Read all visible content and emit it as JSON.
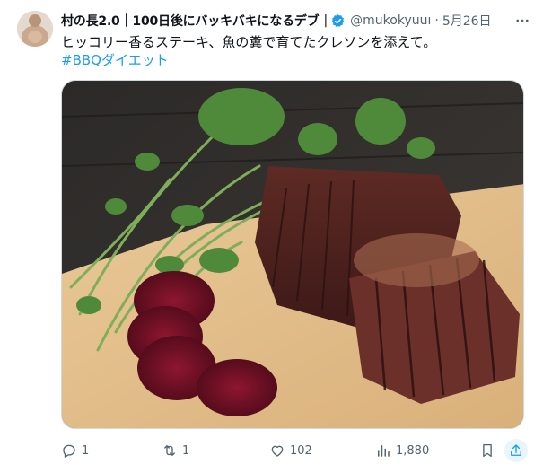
{
  "post": {
    "display_name": "村の長2.0｜100日後にバッキバキになるデブ",
    "separator": "|",
    "handle": "@mukokyuuı",
    "dot": "·",
    "date": "5月26日",
    "text": "ヒッコリー香るステーキ、魚の糞で育てたクレソンを添えて。",
    "hashtag": "#BBQダイエット"
  },
  "actions": {
    "reply_count": "1",
    "repost_count": "1",
    "like_count": "102",
    "view_count": "1,880"
  },
  "colors": {
    "accent": "#1d9bf0",
    "muted": "#536471",
    "text": "#0f1419"
  },
  "icons": [
    "verified-badge-icon",
    "more-icon",
    "reply-icon",
    "repost-icon",
    "like-icon",
    "views-icon",
    "bookmark-icon",
    "share-icon"
  ]
}
